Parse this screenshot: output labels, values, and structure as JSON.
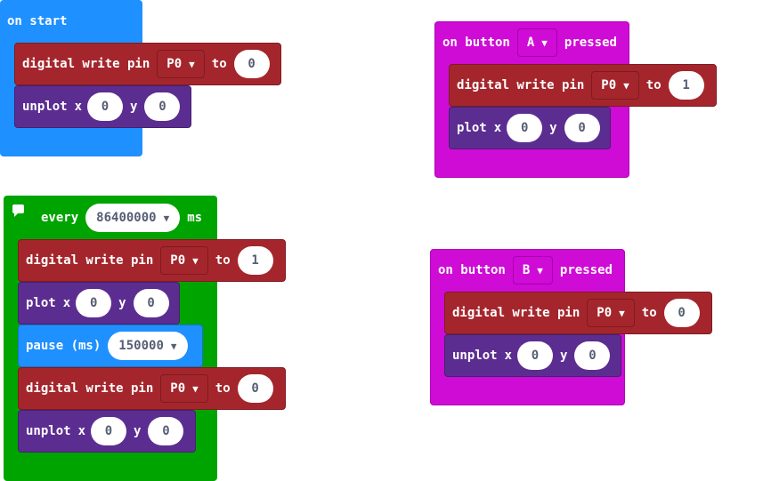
{
  "on_start": {
    "hat_label": "on start",
    "write": {
      "label": "digital write pin",
      "pin": "P0",
      "to_label": "to",
      "value": "0"
    },
    "unplot": {
      "label": "unplot",
      "x_label": "x",
      "x": "0",
      "y_label": "y",
      "y": "0"
    }
  },
  "button_a": {
    "on_label": "on button",
    "button": "A",
    "pressed_label": "pressed",
    "write": {
      "label": "digital write pin",
      "pin": "P0",
      "to_label": "to",
      "value": "1"
    },
    "plot": {
      "label": "plot",
      "x_label": "x",
      "x": "0",
      "y_label": "y",
      "y": "0"
    }
  },
  "every": {
    "every_label": "every",
    "interval": "86400000",
    "ms_label": "ms",
    "write1": {
      "label": "digital write pin",
      "pin": "P0",
      "to_label": "to",
      "value": "1"
    },
    "plot": {
      "label": "plot",
      "x_label": "x",
      "x": "0",
      "y_label": "y",
      "y": "0"
    },
    "pause": {
      "label": "pause (ms)",
      "value": "150000"
    },
    "write2": {
      "label": "digital write pin",
      "pin": "P0",
      "to_label": "to",
      "value": "0"
    },
    "unplot": {
      "label": "unplot",
      "x_label": "x",
      "x": "0",
      "y_label": "y",
      "y": "0"
    }
  },
  "button_b": {
    "on_label": "on button",
    "button": "B",
    "pressed_label": "pressed",
    "write": {
      "label": "digital write pin",
      "pin": "P0",
      "to_label": "to",
      "value": "0"
    },
    "unplot": {
      "label": "unplot",
      "x_label": "x",
      "x": "0",
      "y_label": "y",
      "y": "0"
    }
  },
  "colors": {
    "events": "#1e90ff",
    "input": "#cf0bd6",
    "loops": "#00a400",
    "pins": "#a4262c",
    "led": "#5c2d91"
  }
}
